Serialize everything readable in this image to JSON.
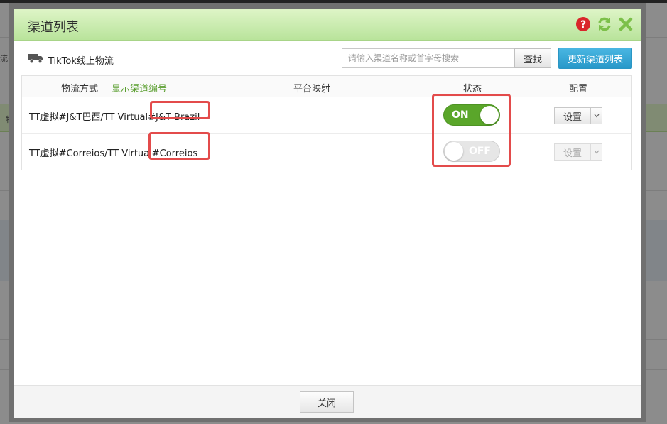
{
  "background": {
    "fragments": [
      "流器",
      "物"
    ]
  },
  "modal": {
    "title": "渠道列表",
    "icons": [
      "help-icon",
      "refresh-icon",
      "close-icon"
    ],
    "carrier": {
      "icon": "truck-icon",
      "name": "TikTok线上物流"
    },
    "search": {
      "placeholder": "请输入渠道名称或首字母搜索",
      "value": "",
      "button_label": "查找"
    },
    "refresh_list_label": "更新渠道列表",
    "table": {
      "headers": {
        "method": "物流方式",
        "show_code": "显示渠道编号",
        "platform_mapping": "平台映射",
        "status": "状态",
        "config": "配置"
      },
      "rows": [
        {
          "name": "TT虚拟#J&T巴西/TT Virtual#J&T Brazil",
          "status": "ON",
          "config_label": "设置",
          "config_enabled": true
        },
        {
          "name": "TT虚拟#Correios/TT Virtual#Correios",
          "status": "OFF",
          "config_label": "设置",
          "config_enabled": false
        }
      ]
    },
    "footer": {
      "close_label": "关闭"
    },
    "colors": {
      "header_green": "#b8e39a",
      "toggle_on": "#5aa62a",
      "toggle_off": "#e6e6e6",
      "primary_button": "#2898c9",
      "highlight": "#e34b4b",
      "link_green": "#5a9e2f"
    }
  }
}
